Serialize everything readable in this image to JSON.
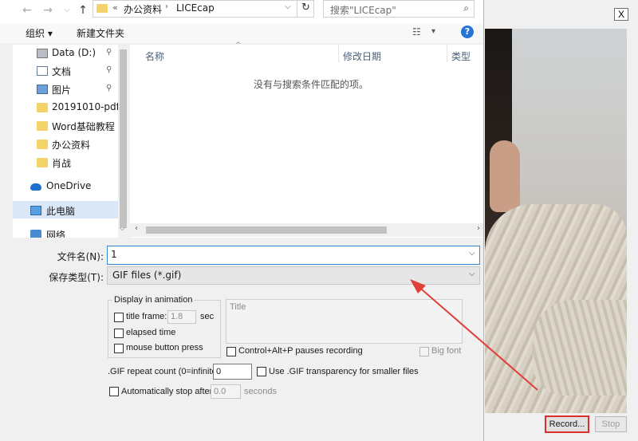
{
  "address": {
    "prefix": "«",
    "crumbs": [
      "办公资料",
      "LICEcap"
    ]
  },
  "search": {
    "placeholder": "搜索\"LICEcap\""
  },
  "toolbar": {
    "organize": "组织 ▾",
    "new_folder": "新建文件夹"
  },
  "nav_items": [
    {
      "label": "Data (D:)",
      "icon": "drive-icon",
      "pinned": true
    },
    {
      "label": "文档",
      "icon": "document-icon",
      "pinned": true
    },
    {
      "label": "图片",
      "icon": "picture-icon",
      "pinned": true
    },
    {
      "label": "20191010-pdf",
      "icon": "folder-icon",
      "pinned": false
    },
    {
      "label": "Word基础教程",
      "icon": "folder-icon",
      "pinned": false
    },
    {
      "label": "办公资料",
      "icon": "folder-icon",
      "pinned": false
    },
    {
      "label": "肖战",
      "icon": "folder-icon",
      "pinned": false
    },
    {
      "label": "OneDrive",
      "icon": "cloud-icon",
      "pinned": false
    },
    {
      "label": "此电脑",
      "icon": "computer-icon",
      "pinned": false,
      "selected": true
    },
    {
      "label": "网络",
      "icon": "network-icon",
      "pinned": false
    }
  ],
  "columns": {
    "name": "名称",
    "modified": "修改日期",
    "type": "类型"
  },
  "empty_message": "没有与搜索条件匹配的项。",
  "filename": {
    "label": "文件名(N):",
    "value": "1"
  },
  "filetype": {
    "label": "保存类型(T):",
    "value": "GIF files (*.gif)"
  },
  "options": {
    "group_title": "Display in animation",
    "title_frame": "title frame:",
    "title_frame_value": "1.8",
    "sec": "sec",
    "elapsed_time": "elapsed time",
    "mouse_button_press": "mouse button press",
    "title_placeholder": "Title",
    "pause_hotkey": "Control+Alt+P pauses recording",
    "big_font": "Big font",
    "repeat_label": ".GIF repeat count (0=infinite):",
    "repeat_value": "0",
    "transparency": "Use .GIF transparency for smaller files",
    "auto_stop": "Automatically stop after",
    "auto_stop_value": "0.0",
    "seconds": "seconds"
  },
  "licecap": {
    "record": "Record...",
    "stop": "Stop",
    "close": "X"
  },
  "colors": {
    "accent": "#2574d6",
    "highlight": "#d9312c",
    "selection": "#d9e7f7"
  }
}
